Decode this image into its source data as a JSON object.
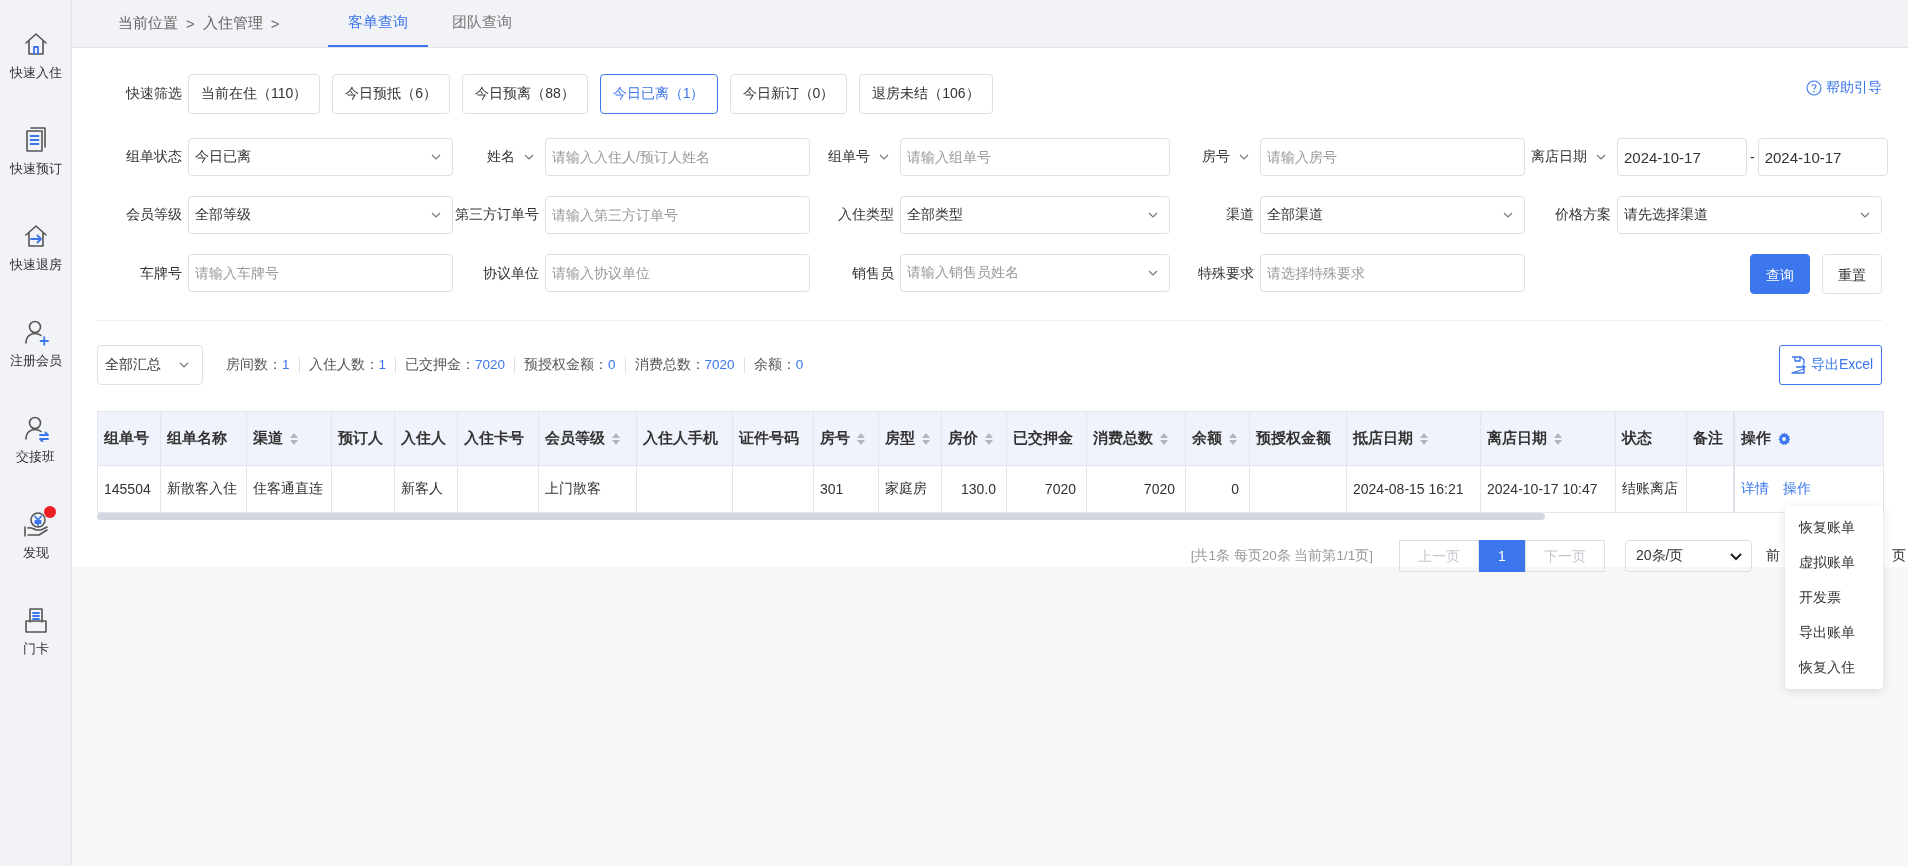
{
  "sidebar": {
    "items": [
      {
        "label": "快速入住",
        "badge": false
      },
      {
        "label": "快速预订",
        "badge": false
      },
      {
        "label": "快速退房",
        "badge": false
      },
      {
        "label": "注册会员",
        "badge": false
      },
      {
        "label": "交接班",
        "badge": false
      },
      {
        "label": "发现",
        "badge": true
      },
      {
        "label": "门卡",
        "badge": false
      }
    ]
  },
  "breadcrumb": [
    "当前位置",
    ">",
    "入住管理",
    ">"
  ],
  "tabs": [
    {
      "label": "客单查询",
      "selected": true
    },
    {
      "label": "团队查询",
      "selected": false
    }
  ],
  "quick_filter": {
    "label": "快速筛选",
    "buttons": [
      {
        "label": "当前在住（110）",
        "selected": false
      },
      {
        "label": "今日预抵（6）",
        "selected": false
      },
      {
        "label": "今日预离（88）",
        "selected": false
      },
      {
        "label": "今日已离（1）",
        "selected": true
      },
      {
        "label": "今日新订（0）",
        "selected": false
      },
      {
        "label": "退房未结（106）",
        "selected": false
      }
    ]
  },
  "help_link": "帮助引导",
  "filters": [
    [
      {
        "label": "组单状态",
        "label_dropdown": false,
        "kind": "select",
        "value": "今日已离"
      },
      {
        "label": "姓名",
        "label_dropdown": true,
        "kind": "input",
        "placeholder": "请输入入住人/预订人姓名"
      },
      {
        "label": "组单号",
        "label_dropdown": true,
        "kind": "input",
        "placeholder": "请输入组单号"
      },
      {
        "label": "房号",
        "label_dropdown": true,
        "kind": "input",
        "placeholder": "请输入房号"
      },
      {
        "label": "离店日期",
        "label_dropdown": true,
        "kind": "date_range",
        "values": [
          "2024-10-17",
          "2024-10-17"
        ],
        "separator": "-"
      }
    ],
    [
      {
        "label": "会员等级",
        "label_dropdown": false,
        "kind": "select",
        "value": "全部等级"
      },
      {
        "label": "第三方订单号",
        "label_dropdown": false,
        "kind": "input",
        "placeholder": "请输入第三方订单号"
      },
      {
        "label": "入住类型",
        "label_dropdown": false,
        "kind": "select",
        "value": "全部类型"
      },
      {
        "label": "渠道",
        "label_dropdown": false,
        "kind": "select",
        "value": "全部渠道"
      },
      {
        "label": "价格方案",
        "label_dropdown": false,
        "kind": "select",
        "value": "请先选择渠道"
      }
    ],
    [
      {
        "label": "车牌号",
        "label_dropdown": false,
        "kind": "input",
        "placeholder": "请输入车牌号"
      },
      {
        "label": "协议单位",
        "label_dropdown": false,
        "kind": "input",
        "placeholder": "请输入协议单位"
      },
      {
        "label": "销售员",
        "label_dropdown": false,
        "kind": "select",
        "placeholder": "请输入销售员姓名"
      },
      {
        "label": "特殊要求",
        "label_dropdown": false,
        "kind": "input",
        "placeholder": "请选择特殊要求"
      },
      {
        "kind": "buttons",
        "buttons": [
          {
            "label": "查询",
            "primary": true
          },
          {
            "label": "重置",
            "primary": false
          }
        ]
      }
    ]
  ],
  "summary": {
    "scope": "全部汇总",
    "stats": [
      {
        "label": "房间数：",
        "value": "1"
      },
      {
        "label": "入住人数：",
        "value": "1"
      },
      {
        "label": "已交押金：",
        "value": "7020"
      },
      {
        "label": "预授权金额：",
        "value": "0"
      },
      {
        "label": "消费总数：",
        "value": "7020"
      },
      {
        "label": "余额：",
        "value": "0"
      }
    ],
    "export_button": "导出Excel"
  },
  "table": {
    "columns": [
      {
        "label": "组单号",
        "sortable": false,
        "kind": "text"
      },
      {
        "label": "组单名称",
        "sortable": false,
        "kind": "text"
      },
      {
        "label": "渠道",
        "sortable": true,
        "kind": "text"
      },
      {
        "label": "预订人",
        "sortable": false,
        "kind": "text"
      },
      {
        "label": "入住人",
        "sortable": false,
        "kind": "text"
      },
      {
        "label": "入住卡号",
        "sortable": false,
        "kind": "text"
      },
      {
        "label": "会员等级",
        "sortable": true,
        "kind": "text"
      },
      {
        "label": "入住人手机",
        "sortable": false,
        "kind": "text"
      },
      {
        "label": "证件号码",
        "sortable": false,
        "kind": "text"
      },
      {
        "label": "房号",
        "sortable": true,
        "kind": "text"
      },
      {
        "label": "房型",
        "sortable": true,
        "kind": "text"
      },
      {
        "label": "房价",
        "sortable": true,
        "kind": "number"
      },
      {
        "label": "已交押金",
        "sortable": false,
        "kind": "number"
      },
      {
        "label": "消费总数",
        "sortable": true,
        "kind": "number"
      },
      {
        "label": "余额",
        "sortable": true,
        "kind": "number"
      },
      {
        "label": "预授权金额",
        "sortable": false,
        "kind": "number"
      },
      {
        "label": "抵店日期",
        "sortable": true,
        "kind": "text"
      },
      {
        "label": "离店日期",
        "sortable": true,
        "kind": "text"
      },
      {
        "label": "状态",
        "sortable": false,
        "kind": "text"
      },
      {
        "label": "备注",
        "sortable": false,
        "kind": "text"
      },
      {
        "label": "操作",
        "sortable": false,
        "kind": "actions"
      }
    ],
    "rows": [
      {
        "cells": [
          "145504",
          "新散客入住",
          "住客通直连",
          null,
          "新客人",
          null,
          "上门散客",
          null,
          null,
          "301",
          "家庭房",
          "130.0",
          "7020",
          "7020",
          "0",
          null,
          "2024-08-15 16:21",
          "2024-10-17 10:47",
          "结账离店",
          null
        ],
        "actions": [
          "详情",
          "操作"
        ]
      }
    ]
  },
  "action_menu": {
    "items": [
      "恢复账单",
      "虚拟账单",
      "开发票",
      "导出账单",
      "恢复入住"
    ]
  },
  "pagination": {
    "info": "[共1条 每页20条 当前第1/1页]",
    "prev": {
      "label": "上一页",
      "disabled": true
    },
    "pages": [
      {
        "label": "1",
        "selected": true
      }
    ],
    "next": {
      "label": "下一页",
      "disabled": true
    },
    "page_size": "20条/页",
    "goto_label": "前",
    "goto_suffix": "页"
  }
}
